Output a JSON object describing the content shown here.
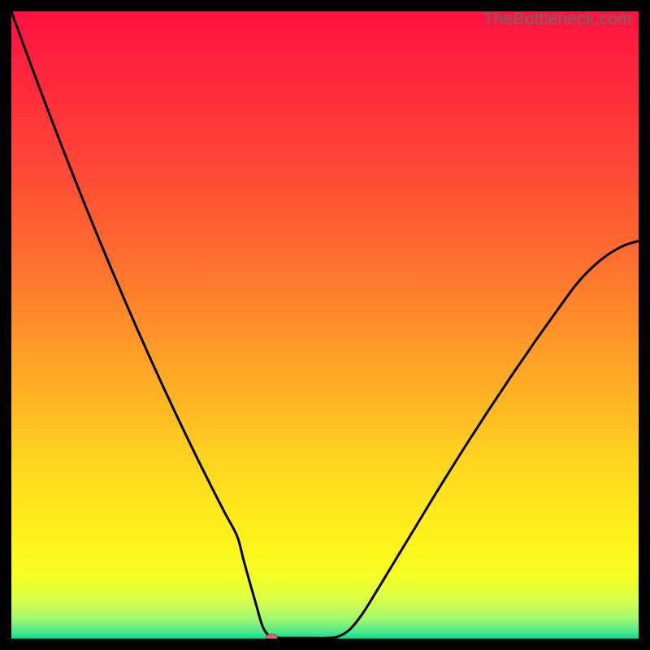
{
  "watermark": "TheBottleneck.com",
  "chart_data": {
    "type": "line",
    "title": "",
    "xlabel": "",
    "ylabel": "",
    "xlim": [
      0,
      100
    ],
    "ylim": [
      0,
      100
    ],
    "x": [
      0,
      2,
      4,
      6,
      8,
      10,
      12,
      14,
      16,
      18,
      20,
      22,
      24,
      26,
      28,
      30,
      32,
      34,
      36,
      37,
      38,
      39,
      40,
      41,
      42,
      43,
      44,
      46,
      48,
      50,
      52,
      54,
      56,
      58,
      60,
      62,
      64,
      66,
      68,
      70,
      72,
      74,
      76,
      78,
      80,
      82,
      84,
      86,
      88,
      90,
      92,
      94,
      96,
      98,
      100
    ],
    "values": [
      100,
      94.5,
      89.1,
      83.8,
      78.6,
      73.5,
      68.5,
      63.6,
      58.8,
      54.1,
      49.5,
      45.0,
      40.6,
      36.3,
      32.1,
      28.0,
      24.0,
      20.1,
      16.3,
      12.6,
      9.0,
      5.5,
      2.1,
      0.5,
      0.2,
      0.1,
      0.1,
      0.1,
      0.1,
      0.1,
      0.3,
      1.5,
      4.0,
      7.2,
      10.5,
      13.8,
      17.1,
      20.4,
      23.7,
      26.9,
      30.1,
      33.2,
      36.3,
      39.3,
      42.3,
      45.2,
      48.1,
      50.9,
      53.7,
      56.4,
      58.6,
      60.4,
      61.8,
      62.8,
      63.4
    ],
    "marker": {
      "x": 41.5,
      "y": 0.1
    },
    "background_gradient": {
      "stops": [
        {
          "pos": 0.0,
          "color": "#ff1141"
        },
        {
          "pos": 0.12,
          "color": "#ff2a3c"
        },
        {
          "pos": 0.25,
          "color": "#ff4836"
        },
        {
          "pos": 0.38,
          "color": "#ff6a30"
        },
        {
          "pos": 0.5,
          "color": "#ff8f2a"
        },
        {
          "pos": 0.62,
          "color": "#ffb524"
        },
        {
          "pos": 0.74,
          "color": "#ffdb1e"
        },
        {
          "pos": 0.84,
          "color": "#fff21a"
        },
        {
          "pos": 0.9,
          "color": "#f6ff24"
        },
        {
          "pos": 0.94,
          "color": "#d6ff4a"
        },
        {
          "pos": 0.97,
          "color": "#9cf770"
        },
        {
          "pos": 0.99,
          "color": "#4be88c"
        },
        {
          "pos": 1.0,
          "color": "#00d98f"
        }
      ]
    }
  }
}
